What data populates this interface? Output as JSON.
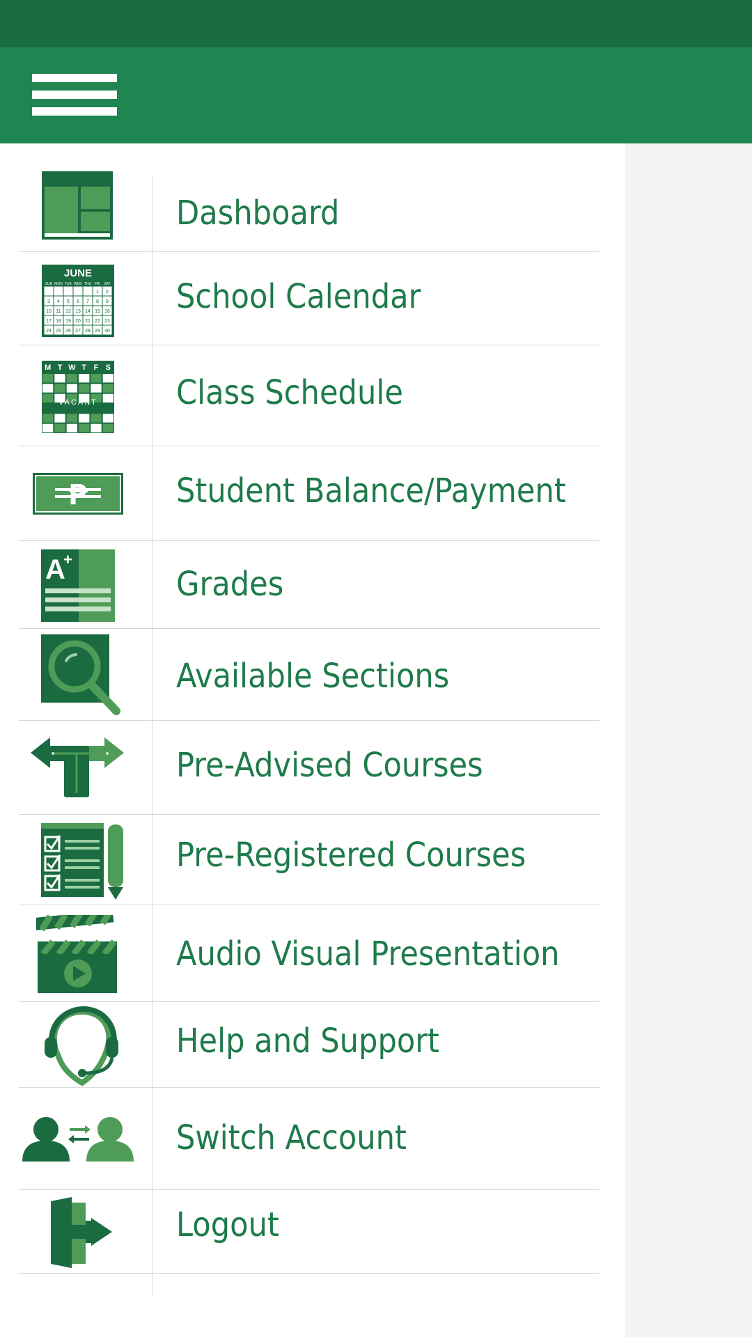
{
  "colors": {
    "status_bar": "#196b40",
    "app_bar": "#1f8651",
    "accent_dark": "#1a6b40",
    "accent_light": "#4f9c58",
    "label_green": "#1e7b4a",
    "drawer_bg": "#ffffff",
    "scrim_bg": "#f4f4f4",
    "divider": "#d6d6d6"
  },
  "header": {
    "menu_icon": "hamburger-menu-icon"
  },
  "calendar_icon": {
    "month": "JUNE",
    "days": [
      "SUN",
      "MON",
      "TUE",
      "WED",
      "THU",
      "FRI",
      "SAT"
    ],
    "dates": [
      "1",
      "2",
      "3",
      "4",
      "5",
      "6",
      "7",
      "8",
      "9",
      "10",
      "11",
      "12",
      "13",
      "14",
      "15",
      "16",
      "17",
      "18",
      "19",
      "20",
      "21",
      "22",
      "23",
      "24",
      "25",
      "26",
      "27",
      "28",
      "29",
      "30"
    ]
  },
  "schedule_icon": {
    "days": [
      "M",
      "T",
      "W",
      "T",
      "F",
      "S"
    ],
    "banner": "VACANT"
  },
  "grades_icon": {
    "grade": "A",
    "modifier": "+"
  },
  "payment_icon": {
    "currency_symbol": "₱"
  },
  "menu": {
    "items": [
      {
        "label": "Dashboard",
        "icon": "dashboard-icon"
      },
      {
        "label": "School Calendar",
        "icon": "calendar-icon"
      },
      {
        "label": "Class Schedule",
        "icon": "schedule-icon"
      },
      {
        "label": "Student Balance/Payment",
        "icon": "peso-bill-icon"
      },
      {
        "label": "Grades",
        "icon": "grade-sheet-icon"
      },
      {
        "label": "Available Sections",
        "icon": "magnifier-icon"
      },
      {
        "label": "Pre-Advised Courses",
        "icon": "direction-sign-icon"
      },
      {
        "label": "Pre-Registered Courses",
        "icon": "checklist-pencil-icon"
      },
      {
        "label": "Audio Visual Presentation",
        "icon": "clapperboard-icon"
      },
      {
        "label": "Help and Support",
        "icon": "headset-icon"
      },
      {
        "label": "Switch Account",
        "icon": "switch-users-icon"
      },
      {
        "label": "Logout",
        "icon": "exit-door-icon"
      }
    ]
  }
}
